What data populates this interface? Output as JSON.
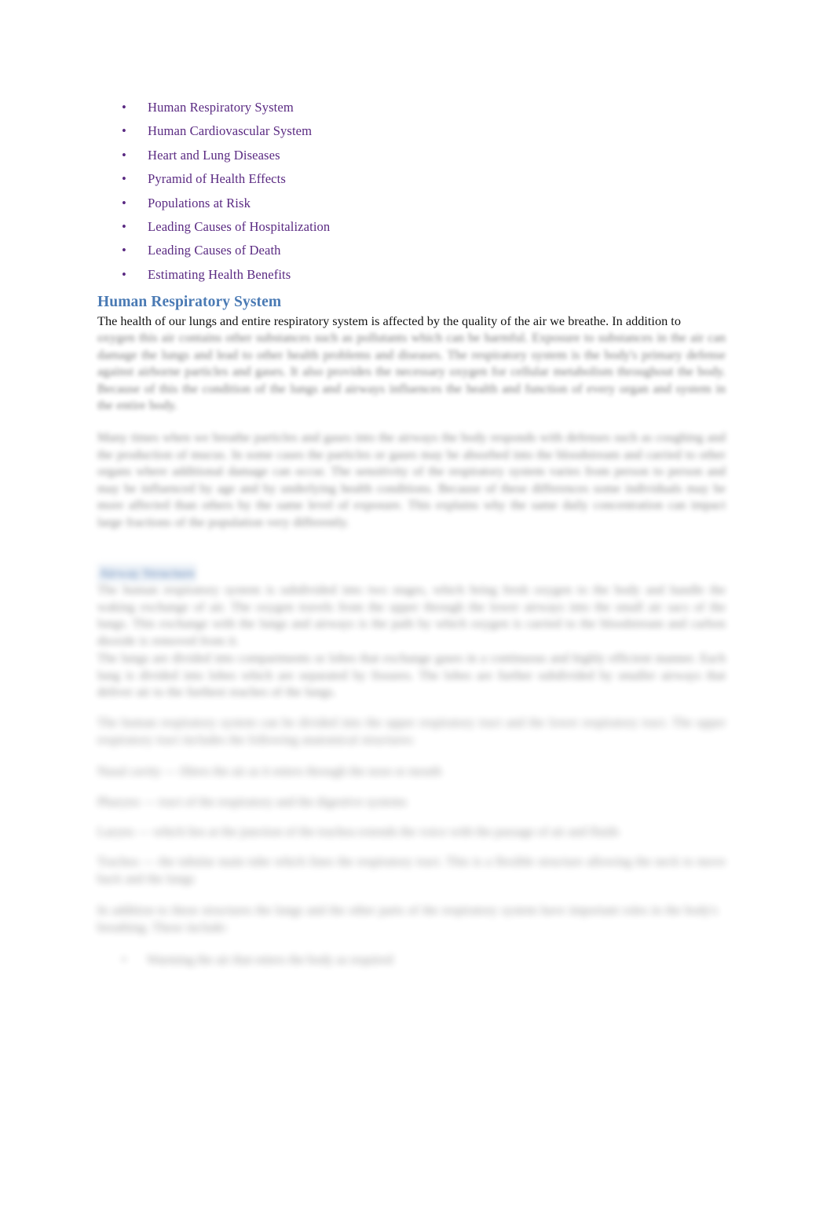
{
  "document": {
    "background_color": "#ffffff",
    "link_color": "#5a2a82",
    "heading_color": "#4a7ab4",
    "body_color": "#141414",
    "highlight_color": "#dbe5f1"
  },
  "toc": {
    "bullet_glyph": "•",
    "items": [
      {
        "label": "Human Respiratory System"
      },
      {
        "label": "Human Cardiovascular System"
      },
      {
        "label": "Heart and Lung Diseases"
      },
      {
        "label": "Pyramid of Health Effects"
      },
      {
        "label": "Populations at Risk"
      },
      {
        "label": "Leading Causes of Hospitalization"
      },
      {
        "label": "Leading Causes of Death"
      },
      {
        "label": "Estimating Health Benefits"
      }
    ]
  },
  "section": {
    "heading": "Human Respiratory System",
    "first_line": "The health of our lungs and entire respiratory system is affected by the quality of the air we breathe. In addition to"
  },
  "blurred": {
    "note": "Text below the first body line is blurred beyond legibility in the source screenshot; the blocks below reproduce the visual line structure only.",
    "para1": "oxygen this air contains other substances such as pollutants which can be harmful. Exposure to substances in the air can damage the lungs and lead to other health problems and diseases. The respiratory system is the body's primary defense against airborne particles and gases. It also provides the necessary oxygen for cellular metabolism throughout the body. Because of this the condition of the lungs and airways influences the health and function of every organ and system in the entire body.",
    "para2": "Many times when we breathe particles and gases into the airways the body responds with defenses such as coughing and the production of mucus. In some cases the particles or gases may be absorbed into the bloodstream and carried to other organs where additional damage can occur. The sensitivity of the respiratory system varies from person to person and may be influenced by age and by underlying health conditions. Because of these differences some individuals may be more affected than others by the same level of exposure. This explains why the same daily concentration can impact large fractions of the population very differently.",
    "blue_heading": "Airway Structure",
    "para3": "The human respiratory system is subdivided into two stages, which bring fresh oxygen to the body and handle the waking exchange of air. The oxygen travels from the upper through the lower airways into the small air sacs of the lungs. This exchange with the lungs and airways is the path by which oxygen is carried to the bloodstream and carbon dioxide is removed from it.",
    "para4": "The lungs are divided into compartments or lobes that exchange gases in a continuous and highly efficient manner. Each lung is divided into lobes which are separated by fissures. The lobes are further subdivided by smaller airways that deliver air to the furthest reaches of the lungs.",
    "para5": "The human respiratory system can be divided into the upper respiratory tract and the lower respiratory tract. The upper respiratory tract includes the following anatomical structures:",
    "short1": "Nasal cavity — filters the air as it enters through the nose or mouth",
    "short2": "Pharynx — tract of the respiratory and the digestive systems",
    "short3": "Larynx — which lies at the junction of the trachea extends the voice with the passage of air and fluids",
    "short4": "Trachea — the tubular main tube which lines the respiratory tract. This is a flexible structure allowing the neck to move back and the lungs",
    "para6": "In addition to these structures the lungs and the other parts of the respiratory system have important roles in the body's breathing. These include:",
    "bullet_mark": "•",
    "bullet_label": "Warming the air that enters the body as required"
  }
}
